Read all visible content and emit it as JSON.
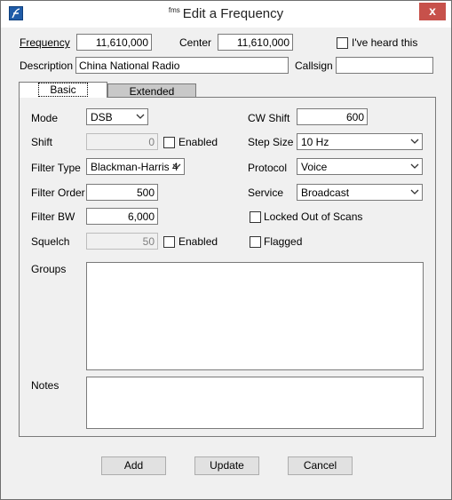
{
  "window": {
    "brand": "fms",
    "title": "Edit a Frequency",
    "close_glyph": "x"
  },
  "header": {
    "frequency_label": "Frequency",
    "frequency_value": "11,610,000",
    "center_label": "Center",
    "center_value": "11,610,000",
    "heard_label": "I've heard this",
    "description_label": "Description",
    "description_value": "China National Radio",
    "callsign_label": "Callsign",
    "callsign_value": ""
  },
  "tabs": [
    {
      "label": "Basic",
      "active": true
    },
    {
      "label": "Extended",
      "active": false
    }
  ],
  "basic": {
    "mode_label": "Mode",
    "mode_value": "DSB",
    "shift_label": "Shift",
    "shift_value": "0",
    "shift_enabled_label": "Enabled",
    "filter_type_label": "Filter Type",
    "filter_type_value": "Blackman-Harris 4",
    "filter_order_label": "Filter Order",
    "filter_order_value": "500",
    "filter_bw_label": "Filter BW",
    "filter_bw_value": "6,000",
    "squelch_label": "Squelch",
    "squelch_value": "50",
    "squelch_enabled_label": "Enabled",
    "cw_shift_label": "CW Shift",
    "cw_shift_value": "600",
    "step_size_label": "Step Size",
    "step_size_value": "10 Hz",
    "protocol_label": "Protocol",
    "protocol_value": "Voice",
    "service_label": "Service",
    "service_value": "Broadcast",
    "locked_label": "Locked Out of Scans",
    "flagged_label": "Flagged",
    "groups_label": "Groups",
    "notes_label": "Notes"
  },
  "buttons": {
    "add": "Add",
    "update": "Update",
    "cancel": "Cancel"
  },
  "colors": {
    "accent_icon": "#1f5ca8",
    "close": "#c7514b",
    "dialog_bg": "#f0f0f0"
  }
}
